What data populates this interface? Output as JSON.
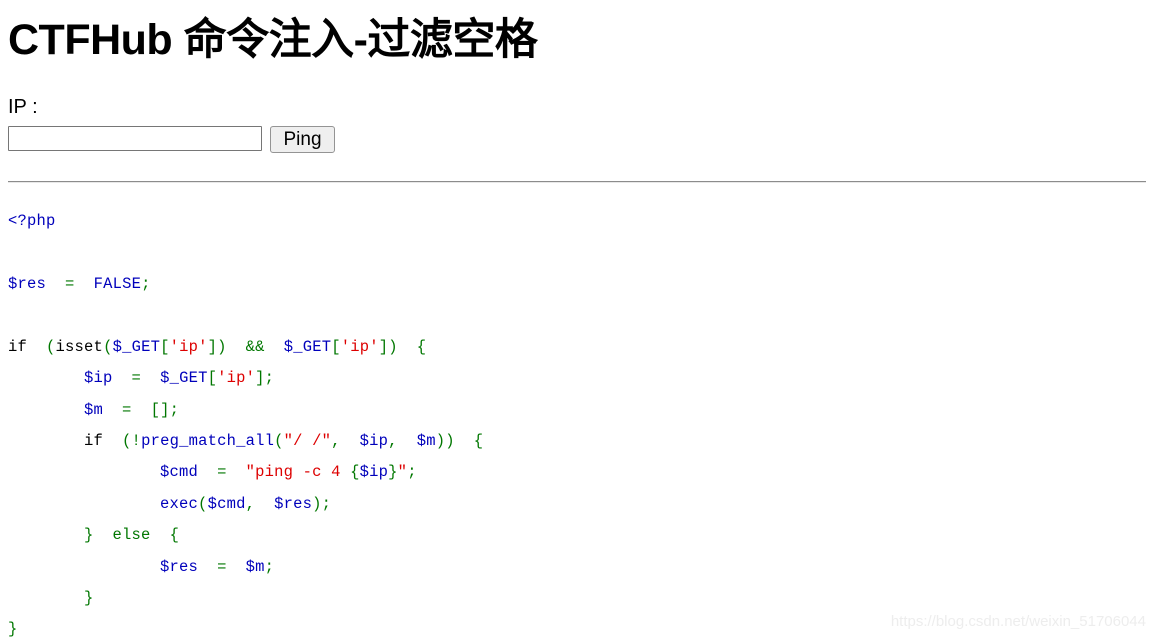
{
  "page": {
    "title": "CTFHub 命令注入-过滤空格"
  },
  "form": {
    "ip_label": "IP :",
    "ip_value": "",
    "ip_placeholder": "",
    "ping_label": "Ping"
  },
  "code": {
    "language": "php",
    "colors": {
      "tag": "#0000BB",
      "keyword": "#007700",
      "string": "#DD0000",
      "variable": "#0000BB",
      "function": "#0000BB",
      "default": "#000000"
    },
    "lines": [
      {
        "id": "l1",
        "tokens": [
          {
            "t": "<?php",
            "c": "tag"
          }
        ]
      },
      {
        "id": "l2",
        "tokens": []
      },
      {
        "id": "l3",
        "tokens": [
          {
            "t": "$res",
            "c": "var"
          },
          {
            "t": "  ",
            "c": "def"
          },
          {
            "t": "=",
            "c": "kw"
          },
          {
            "t": "  ",
            "c": "def"
          },
          {
            "t": "FALSE",
            "c": "var"
          },
          {
            "t": ";",
            "c": "kw"
          }
        ]
      },
      {
        "id": "l4",
        "tokens": []
      },
      {
        "id": "l5",
        "tokens": [
          {
            "t": "if",
            "c": "def"
          },
          {
            "t": "  ",
            "c": "def"
          },
          {
            "t": "(",
            "c": "kw"
          },
          {
            "t": "isset",
            "c": "def"
          },
          {
            "t": "(",
            "c": "kw"
          },
          {
            "t": "$_GET",
            "c": "var"
          },
          {
            "t": "[",
            "c": "kw"
          },
          {
            "t": "'ip'",
            "c": "str"
          },
          {
            "t": "])",
            "c": "kw"
          },
          {
            "t": "  ",
            "c": "def"
          },
          {
            "t": "&&",
            "c": "kw"
          },
          {
            "t": "  ",
            "c": "def"
          },
          {
            "t": "$_GET",
            "c": "var"
          },
          {
            "t": "[",
            "c": "kw"
          },
          {
            "t": "'ip'",
            "c": "str"
          },
          {
            "t": "])",
            "c": "kw"
          },
          {
            "t": "  ",
            "c": "def"
          },
          {
            "t": "{",
            "c": "kw"
          }
        ]
      },
      {
        "id": "l6",
        "tokens": [
          {
            "t": "        ",
            "c": "def"
          },
          {
            "t": "$ip",
            "c": "var"
          },
          {
            "t": "  ",
            "c": "def"
          },
          {
            "t": "=",
            "c": "kw"
          },
          {
            "t": "  ",
            "c": "def"
          },
          {
            "t": "$_GET",
            "c": "var"
          },
          {
            "t": "[",
            "c": "kw"
          },
          {
            "t": "'ip'",
            "c": "str"
          },
          {
            "t": "];",
            "c": "kw"
          }
        ]
      },
      {
        "id": "l7",
        "tokens": [
          {
            "t": "        ",
            "c": "def"
          },
          {
            "t": "$m",
            "c": "var"
          },
          {
            "t": "  ",
            "c": "def"
          },
          {
            "t": "=",
            "c": "kw"
          },
          {
            "t": "  ",
            "c": "def"
          },
          {
            "t": "[];",
            "c": "kw"
          }
        ]
      },
      {
        "id": "l8",
        "tokens": [
          {
            "t": "        ",
            "c": "def"
          },
          {
            "t": "if",
            "c": "def"
          },
          {
            "t": "  ",
            "c": "def"
          },
          {
            "t": "(!",
            "c": "kw"
          },
          {
            "t": "preg_match_all",
            "c": "fn"
          },
          {
            "t": "(",
            "c": "kw"
          },
          {
            "t": "\"/ /\"",
            "c": "str"
          },
          {
            "t": ",",
            "c": "kw"
          },
          {
            "t": "  ",
            "c": "def"
          },
          {
            "t": "$ip",
            "c": "var"
          },
          {
            "t": ",",
            "c": "kw"
          },
          {
            "t": "  ",
            "c": "def"
          },
          {
            "t": "$m",
            "c": "var"
          },
          {
            "t": "))",
            "c": "kw"
          },
          {
            "t": "  ",
            "c": "def"
          },
          {
            "t": "{",
            "c": "kw"
          }
        ]
      },
      {
        "id": "l9",
        "tokens": [
          {
            "t": "                ",
            "c": "def"
          },
          {
            "t": "$cmd",
            "c": "var"
          },
          {
            "t": "  ",
            "c": "def"
          },
          {
            "t": "=",
            "c": "kw"
          },
          {
            "t": "  ",
            "c": "def"
          },
          {
            "t": "\"ping -c 4 ",
            "c": "str"
          },
          {
            "t": "{",
            "c": "kw"
          },
          {
            "t": "$ip",
            "c": "var"
          },
          {
            "t": "}",
            "c": "kw"
          },
          {
            "t": "\"",
            "c": "str"
          },
          {
            "t": ";",
            "c": "kw"
          }
        ]
      },
      {
        "id": "l10",
        "tokens": [
          {
            "t": "                ",
            "c": "def"
          },
          {
            "t": "exec",
            "c": "fn"
          },
          {
            "t": "(",
            "c": "kw"
          },
          {
            "t": "$cmd",
            "c": "var"
          },
          {
            "t": ",",
            "c": "kw"
          },
          {
            "t": "  ",
            "c": "def"
          },
          {
            "t": "$res",
            "c": "var"
          },
          {
            "t": ");",
            "c": "kw"
          }
        ]
      },
      {
        "id": "l11",
        "tokens": [
          {
            "t": "        ",
            "c": "def"
          },
          {
            "t": "}",
            "c": "kw"
          },
          {
            "t": "  ",
            "c": "def"
          },
          {
            "t": "else",
            "c": "kw"
          },
          {
            "t": "  ",
            "c": "def"
          },
          {
            "t": "{",
            "c": "kw"
          }
        ]
      },
      {
        "id": "l12",
        "tokens": [
          {
            "t": "                ",
            "c": "def"
          },
          {
            "t": "$res",
            "c": "var"
          },
          {
            "t": "  ",
            "c": "def"
          },
          {
            "t": "=",
            "c": "kw"
          },
          {
            "t": "  ",
            "c": "def"
          },
          {
            "t": "$m",
            "c": "var"
          },
          {
            "t": ";",
            "c": "kw"
          }
        ]
      },
      {
        "id": "l13",
        "tokens": [
          {
            "t": "        ",
            "c": "def"
          },
          {
            "t": "}",
            "c": "kw"
          }
        ]
      },
      {
        "id": "l14",
        "tokens": [
          {
            "t": "}",
            "c": "kw"
          }
        ]
      }
    ]
  },
  "watermark": {
    "text": "https://blog.csdn.net/weixin_51706044"
  }
}
